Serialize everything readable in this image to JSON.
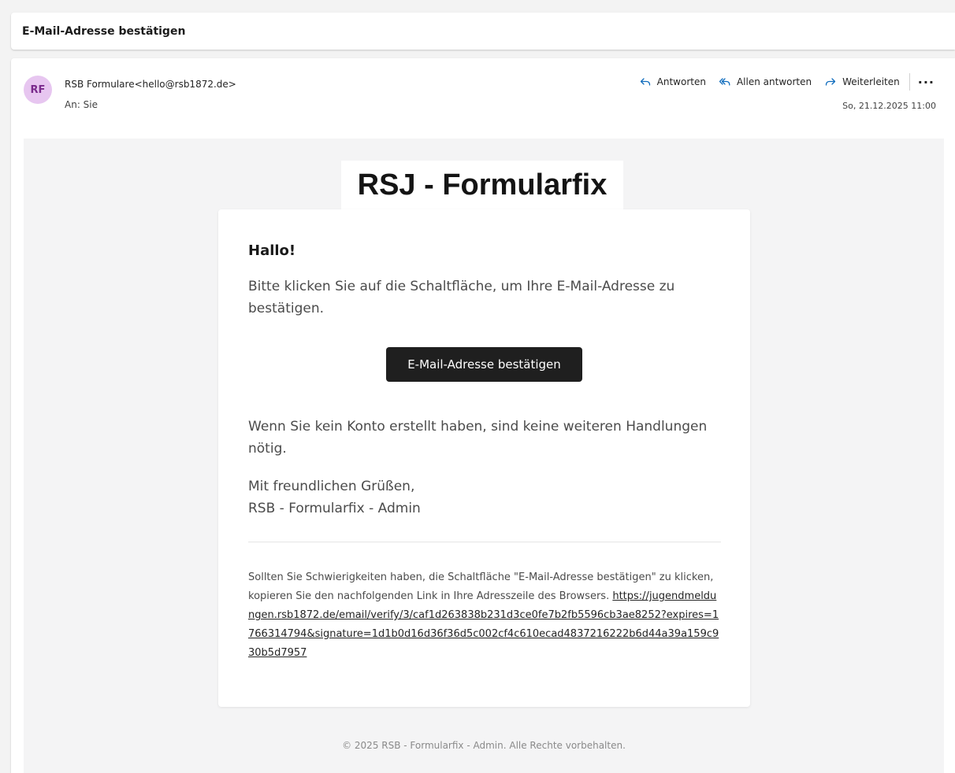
{
  "subject": "E-Mail-Adresse bestätigen",
  "sender": {
    "initials": "RF",
    "from": "RSB Formulare<hello@rsb1872.de>",
    "to": "An: Sie",
    "date": "So, 21.12.2025 11:00",
    "avatar_color": "#e7c6f0"
  },
  "actions": {
    "reply": "Antworten",
    "reply_all": "Allen antworten",
    "forward": "Weiterleiten",
    "more": "···"
  },
  "email": {
    "logo_text": "RSJ - Formularfix",
    "greeting": "Hallo!",
    "intro": "Bitte klicken Sie auf die Schaltfläche, um Ihre E-Mail-Adresse zu bestätigen.",
    "button": "E-Mail-Adresse bestätigen",
    "no_account": "Wenn Sie kein Konto erstellt haben, sind keine weiteren Handlungen nötig.",
    "regards": "Mit freundlichen Grüßen,",
    "signature": "RSB - Formularfix - Admin",
    "trouble_text": "Sollten Sie Schwierigkeiten haben, die Schaltfläche \"E-Mail-Adresse bestätigen\" zu klicken, kopieren Sie den nachfolgenden Link in Ihre Adresszeile des Browsers. ",
    "verify_link": "https://jugendmeldungen.rsb1872.de/email/verify/3/caf1d263838b231d3ce0fe7b2fb5596cb3ae8252?expires=1766314794&signature=1d1b0d16d36f36d5c002cf4c610ecad4837216222b6d44a39a159c930b5d7957",
    "footer": "© 2025 RSB - Formularfix - Admin. Alle Rechte vorbehalten."
  },
  "colors": {
    "button_bg": "#1f1f1f",
    "action_icon": "#0f6cbd"
  }
}
